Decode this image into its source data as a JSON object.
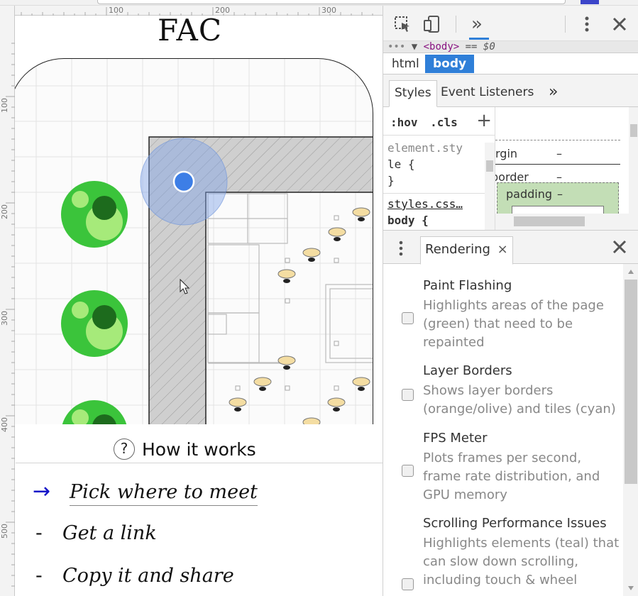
{
  "page": {
    "title": "FAC",
    "how_it_works": "How it works",
    "help_symbol": "?",
    "steps": [
      {
        "marker": "→",
        "text": "Pick where to meet",
        "active": true
      },
      {
        "marker": "-",
        "text": "Get a link",
        "active": false
      },
      {
        "marker": "-",
        "text": "Copy it and share",
        "active": false
      }
    ],
    "ruler": {
      "top_labels": [
        "100",
        "200",
        "300"
      ],
      "left_labels": [
        "100",
        "200",
        "300",
        "400",
        "500"
      ]
    },
    "map_colors": {
      "green_outer": "#3bc43b",
      "green_light": "#a6ea7a",
      "green_dark": "#1d6b1d",
      "location_dot": "#3d7ee6",
      "wall_hatch": "#cfcfcf",
      "stool": "#f4dda2"
    }
  },
  "devtools": {
    "breadcrumb_tag": "<body>",
    "breadcrumb_eq": "== $0",
    "node_tabs": [
      "html",
      "body"
    ],
    "panel_tabs": [
      "Styles",
      "Event Listeners"
    ],
    "more_glyph": "»",
    "filter": {
      "hov": ":hov",
      "cls": ".cls",
      "add": "+"
    },
    "rules": [
      "element.sty",
      "le {",
      "}",
      "styles.css…",
      "body {"
    ],
    "box_model": {
      "margin_label": "rgin",
      "border_label": "border",
      "padding_label": "padding",
      "dash": "–"
    },
    "drawer": {
      "tab_label": "Rendering",
      "close": "×"
    },
    "rendering_options": [
      {
        "title": "Paint Flashing",
        "desc": "Highlights areas of the page (green) that need to be repainted"
      },
      {
        "title": "Layer Borders",
        "desc": "Shows layer borders (orange/olive) and tiles (cyan)"
      },
      {
        "title": "FPS Meter",
        "desc": "Plots frames per second, frame rate distribution, and GPU memory"
      },
      {
        "title": "Scrolling Performance Issues",
        "desc": "Highlights elements (teal) that can slow down scrolling, including touch & wheel"
      }
    ],
    "accent_color": "#2f7fd8"
  }
}
